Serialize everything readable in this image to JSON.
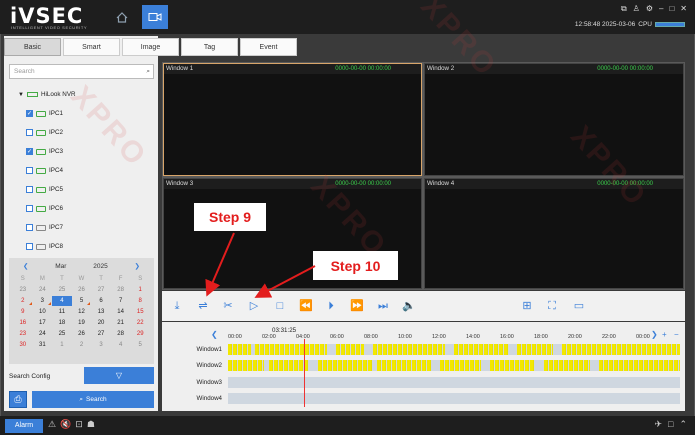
{
  "app": {
    "logo": "iVSEC",
    "logo_sub": "INTELLIGENT VIDEO SECURITY",
    "datetime": "12:58:48 2025-03-06",
    "cpu_label": "CPU"
  },
  "tabs": [
    "Basic",
    "Smart",
    "Image",
    "Tag",
    "Event"
  ],
  "search_placeholder": "Search",
  "tree": {
    "root": "HiLook NVR",
    "cameras": [
      {
        "label": "IPC1",
        "checked": true
      },
      {
        "label": "IPC2",
        "checked": false
      },
      {
        "label": "IPC3",
        "checked": true
      },
      {
        "label": "IPC4",
        "checked": false
      },
      {
        "label": "IPC5",
        "checked": false
      },
      {
        "label": "IPC6",
        "checked": false
      },
      {
        "label": "IPC7",
        "checked": false
      },
      {
        "label": "IPC8",
        "checked": false
      }
    ]
  },
  "calendar": {
    "month": "Mar",
    "year": "2025",
    "weekdays": [
      "S",
      "M",
      "T",
      "W",
      "T",
      "F",
      "S"
    ],
    "days": [
      "23",
      "24",
      "25",
      "26",
      "27",
      "28",
      "1",
      "2",
      "3",
      "4",
      "5",
      "6",
      "7",
      "8",
      "9",
      "10",
      "11",
      "12",
      "13",
      "14",
      "15",
      "16",
      "17",
      "18",
      "19",
      "20",
      "21",
      "22",
      "23",
      "24",
      "25",
      "26",
      "27",
      "28",
      "29",
      "30",
      "31",
      "1",
      "2",
      "3",
      "4",
      "5"
    ],
    "selected": "4"
  },
  "search_config_label": "Search Config",
  "search_button": "Search",
  "windows": [
    {
      "title": "Window 1",
      "time": "0000-00-00 00:00:00"
    },
    {
      "title": "Window 2",
      "time": "0000-00-00 00:00:00"
    },
    {
      "title": "Window 3",
      "time": "0000-00-00 00:00:00"
    },
    {
      "title": "Window 4",
      "time": "0000-00-00 00:00:00"
    }
  ],
  "timeline": {
    "current": "03:31:25",
    "ticks": [
      "00:00",
      "02:00",
      "04:00",
      "06:00",
      "08:00",
      "10:00",
      "12:00",
      "14:00",
      "16:00",
      "18:00",
      "20:00",
      "22:00",
      "00:00"
    ],
    "rows": [
      "Window1",
      "Window2",
      "Window3",
      "Window4"
    ]
  },
  "bottom": {
    "alarm": "Alarm"
  },
  "annotations": {
    "step9": "Step 9",
    "step10": "Step 10",
    "watermark": "XPRO"
  },
  "colors": {
    "accent": "#3b7fd8",
    "recording": "#f2e800",
    "timestamp": "#3bd14c",
    "callout_text": "#e31d1d"
  }
}
